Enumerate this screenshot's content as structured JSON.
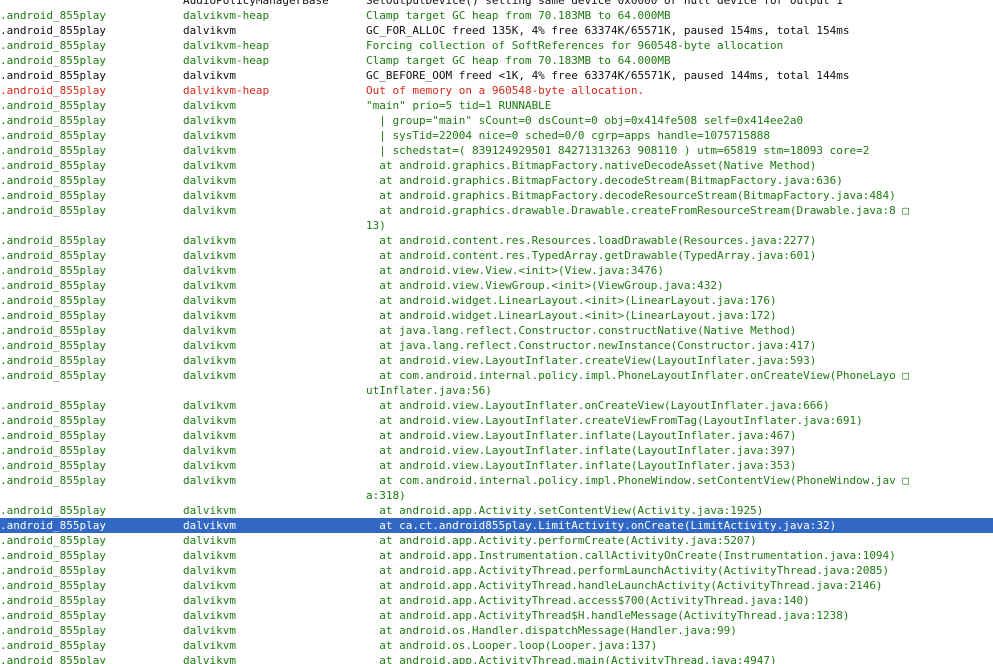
{
  "colors": {
    "debug": "#1e7a12",
    "info": "#101010",
    "error": "#d42a1a",
    "selection_bg": "#3168c5",
    "selection_fg": "#ffffff"
  },
  "rows": [
    {
      "kind": "log",
      "level": "black",
      "app": "",
      "tag": "AudioPolicyManagerBase",
      "msg": "SetOutputDevice() setting same device 0x0000 or null device for output 1"
    },
    {
      "kind": "log",
      "level": "green",
      "app": ".android_855play",
      "tag": "dalvikvm-heap",
      "msg": "Clamp target GC heap from 70.183MB to 64.000MB"
    },
    {
      "kind": "log",
      "level": "black",
      "app": ".android_855play",
      "tag": "dalvikvm",
      "msg": "GC_FOR_ALLOC freed 135K, 4% free 63374K/65571K, paused 154ms, total 154ms"
    },
    {
      "kind": "log",
      "level": "green",
      "app": ".android_855play",
      "tag": "dalvikvm-heap",
      "msg": "Forcing collection of SoftReferences for 960548-byte allocation"
    },
    {
      "kind": "log",
      "level": "green",
      "app": ".android_855play",
      "tag": "dalvikvm-heap",
      "msg": "Clamp target GC heap from 70.183MB to 64.000MB"
    },
    {
      "kind": "log",
      "level": "black",
      "app": ".android_855play",
      "tag": "dalvikvm",
      "msg": "GC_BEFORE_OOM freed <1K, 4% free 63374K/65571K, paused 144ms, total 144ms"
    },
    {
      "kind": "log",
      "level": "red",
      "app": ".android_855play",
      "tag": "dalvikvm-heap",
      "msg": "Out of memory on a 960548-byte allocation."
    },
    {
      "kind": "log",
      "level": "green",
      "app": ".android_855play",
      "tag": "dalvikvm",
      "msg": "\"main\" prio=5 tid=1 RUNNABLE"
    },
    {
      "kind": "log",
      "level": "green",
      "app": ".android_855play",
      "tag": "dalvikvm",
      "msg": "  | group=\"main\" sCount=0 dsCount=0 obj=0x414fe508 self=0x414ee2a0"
    },
    {
      "kind": "log",
      "level": "green",
      "app": ".android_855play",
      "tag": "dalvikvm",
      "msg": "  | sysTid=22004 nice=0 sched=0/0 cgrp=apps handle=1075715888"
    },
    {
      "kind": "log",
      "level": "green",
      "app": ".android_855play",
      "tag": "dalvikvm",
      "msg": "  | schedstat=( 839124929501 84271313263 908110 ) utm=65819 stm=18093 core=2"
    },
    {
      "kind": "log",
      "level": "green",
      "app": ".android_855play",
      "tag": "dalvikvm",
      "msg": "  at android.graphics.BitmapFactory.nativeDecodeAsset(Native Method)"
    },
    {
      "kind": "log",
      "level": "green",
      "app": ".android_855play",
      "tag": "dalvikvm",
      "msg": "  at android.graphics.BitmapFactory.decodeStream(BitmapFactory.java:636)"
    },
    {
      "kind": "log",
      "level": "green",
      "app": ".android_855play",
      "tag": "dalvikvm",
      "msg": "  at android.graphics.BitmapFactory.decodeResourceStream(BitmapFactory.java:484)"
    },
    {
      "kind": "log",
      "level": "green",
      "app": ".android_855play",
      "tag": "dalvikvm",
      "msg": "  at android.graphics.drawable.Drawable.createFromResourceStream(Drawable.java:8 □"
    },
    {
      "kind": "cont",
      "level": "green",
      "msg": "13)"
    },
    {
      "kind": "log",
      "level": "green",
      "app": ".android_855play",
      "tag": "dalvikvm",
      "msg": "  at android.content.res.Resources.loadDrawable(Resources.java:2277)"
    },
    {
      "kind": "log",
      "level": "green",
      "app": ".android_855play",
      "tag": "dalvikvm",
      "msg": "  at android.content.res.TypedArray.getDrawable(TypedArray.java:601)"
    },
    {
      "kind": "log",
      "level": "green",
      "app": ".android_855play",
      "tag": "dalvikvm",
      "msg": "  at android.view.View.<init>(View.java:3476)"
    },
    {
      "kind": "log",
      "level": "green",
      "app": ".android_855play",
      "tag": "dalvikvm",
      "msg": "  at android.view.ViewGroup.<init>(ViewGroup.java:432)"
    },
    {
      "kind": "log",
      "level": "green",
      "app": ".android_855play",
      "tag": "dalvikvm",
      "msg": "  at android.widget.LinearLayout.<init>(LinearLayout.java:176)"
    },
    {
      "kind": "log",
      "level": "green",
      "app": ".android_855play",
      "tag": "dalvikvm",
      "msg": "  at android.widget.LinearLayout.<init>(LinearLayout.java:172)"
    },
    {
      "kind": "log",
      "level": "green",
      "app": ".android_855play",
      "tag": "dalvikvm",
      "msg": "  at java.lang.reflect.Constructor.constructNative(Native Method)"
    },
    {
      "kind": "log",
      "level": "green",
      "app": ".android_855play",
      "tag": "dalvikvm",
      "msg": "  at java.lang.reflect.Constructor.newInstance(Constructor.java:417)"
    },
    {
      "kind": "log",
      "level": "green",
      "app": ".android_855play",
      "tag": "dalvikvm",
      "msg": "  at android.view.LayoutInflater.createView(LayoutInflater.java:593)"
    },
    {
      "kind": "log",
      "level": "green",
      "app": ".android_855play",
      "tag": "dalvikvm",
      "msg": "  at com.android.internal.policy.impl.PhoneLayoutInflater.onCreateView(PhoneLayo □"
    },
    {
      "kind": "cont",
      "level": "green",
      "msg": "utInflater.java:56)"
    },
    {
      "kind": "log",
      "level": "green",
      "app": ".android_855play",
      "tag": "dalvikvm",
      "msg": "  at android.view.LayoutInflater.onCreateView(LayoutInflater.java:666)"
    },
    {
      "kind": "log",
      "level": "green",
      "app": ".android_855play",
      "tag": "dalvikvm",
      "msg": "  at android.view.LayoutInflater.createViewFromTag(LayoutInflater.java:691)"
    },
    {
      "kind": "log",
      "level": "green",
      "app": ".android_855play",
      "tag": "dalvikvm",
      "msg": "  at android.view.LayoutInflater.inflate(LayoutInflater.java:467)"
    },
    {
      "kind": "log",
      "level": "green",
      "app": ".android_855play",
      "tag": "dalvikvm",
      "msg": "  at android.view.LayoutInflater.inflate(LayoutInflater.java:397)"
    },
    {
      "kind": "log",
      "level": "green",
      "app": ".android_855play",
      "tag": "dalvikvm",
      "msg": "  at android.view.LayoutInflater.inflate(LayoutInflater.java:353)"
    },
    {
      "kind": "log",
      "level": "green",
      "app": ".android_855play",
      "tag": "dalvikvm",
      "msg": "  at com.android.internal.policy.impl.PhoneWindow.setContentView(PhoneWindow.jav □"
    },
    {
      "kind": "cont",
      "level": "green",
      "msg": "a:318)"
    },
    {
      "kind": "log",
      "level": "green",
      "app": ".android_855play",
      "tag": "dalvikvm",
      "msg": "  at android.app.Activity.setContentView(Activity.java:1925)"
    },
    {
      "kind": "log",
      "level": "green",
      "app": ".android_855play",
      "tag": "dalvikvm",
      "msg": "  at ca.ct.android855play.LimitActivity.onCreate(LimitActivity.java:32)",
      "selected": true
    },
    {
      "kind": "log",
      "level": "green",
      "app": ".android_855play",
      "tag": "dalvikvm",
      "msg": "  at android.app.Activity.performCreate(Activity.java:5207)"
    },
    {
      "kind": "log",
      "level": "green",
      "app": ".android_855play",
      "tag": "dalvikvm",
      "msg": "  at android.app.Instrumentation.callActivityOnCreate(Instrumentation.java:1094)"
    },
    {
      "kind": "log",
      "level": "green",
      "app": ".android_855play",
      "tag": "dalvikvm",
      "msg": "  at android.app.ActivityThread.performLaunchActivity(ActivityThread.java:2085)"
    },
    {
      "kind": "log",
      "level": "green",
      "app": ".android_855play",
      "tag": "dalvikvm",
      "msg": "  at android.app.ActivityThread.handleLaunchActivity(ActivityThread.java:2146)"
    },
    {
      "kind": "log",
      "level": "green",
      "app": ".android_855play",
      "tag": "dalvikvm",
      "msg": "  at android.app.ActivityThread.access$700(ActivityThread.java:140)"
    },
    {
      "kind": "log",
      "level": "green",
      "app": ".android_855play",
      "tag": "dalvikvm",
      "msg": "  at android.app.ActivityThread$H.handleMessage(ActivityThread.java:1238)"
    },
    {
      "kind": "log",
      "level": "green",
      "app": ".android_855play",
      "tag": "dalvikvm",
      "msg": "  at android.os.Handler.dispatchMessage(Handler.java:99)"
    },
    {
      "kind": "log",
      "level": "green",
      "app": ".android_855play",
      "tag": "dalvikvm",
      "msg": "  at android.os.Looper.loop(Looper.java:137)"
    },
    {
      "kind": "log",
      "level": "green",
      "app": ".android_855play",
      "tag": "dalvikvm",
      "msg": "  at android.app.ActivityThread.main(ActivityThread.java:4947)"
    }
  ]
}
